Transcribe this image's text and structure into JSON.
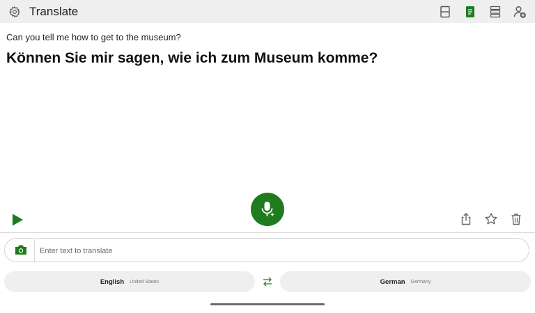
{
  "app": {
    "title": "Translate"
  },
  "icons": {
    "settings": "gear-icon",
    "split_layout": "split-view-icon",
    "document_mode": "document-icon",
    "list_layout": "list-view-icon",
    "add_person": "add-person-icon",
    "play": "play-icon",
    "microphone": "microphone-icon",
    "share": "share-icon",
    "favorite": "star-icon",
    "delete": "trash-icon",
    "camera": "camera-icon",
    "swap": "swap-icon"
  },
  "colors": {
    "accent": "#1e7b1e",
    "topbar": "#efefef",
    "pill": "#efefef"
  },
  "translation": {
    "source_text": "Can you tell me how to get to the museum?",
    "target_text": "Können Sie mir sagen, wie ich zum Museum komme?"
  },
  "input": {
    "placeholder": "Enter text to translate",
    "value": ""
  },
  "languages": {
    "source": {
      "name": "English",
      "region": "United States"
    },
    "target": {
      "name": "German",
      "region": "Germany"
    }
  }
}
